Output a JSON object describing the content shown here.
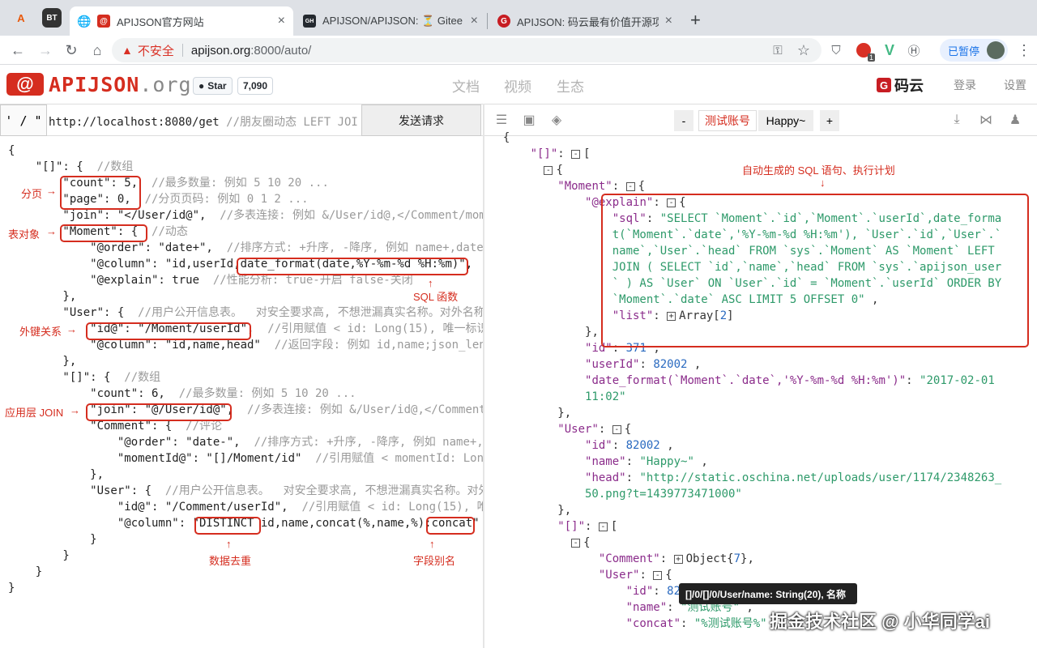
{
  "browser": {
    "pinned": [
      "A",
      "BT",
      "🌐"
    ],
    "tabs": [
      {
        "title": "APIJSON官方网站",
        "favicon": "@"
      },
      {
        "title": "APIJSON/APIJSON: ⏳ Gitee M",
        "favicon": "GH"
      },
      {
        "title": "APIJSON: 码云最有价值开源项目",
        "favicon": "G"
      }
    ],
    "security_label": "不安全",
    "url_host": "apijson.org",
    "url_path": ":8000/auto/",
    "profile_label": "已暂停",
    "ext_badge": "1"
  },
  "site": {
    "logo_mark": "@",
    "logo_name": "APIJSON",
    "logo_suffix": ".org",
    "star_label": "Star",
    "star_count": "7,090",
    "nav": [
      "文档",
      "视频",
      "生态"
    ],
    "gitee_label": "码云",
    "login": "登录",
    "settings": "设置"
  },
  "request": {
    "method": "' / \"",
    "url": "http://localhost:8080/get",
    "url_comment": "  //朋友圈动态 LEFT JOI",
    "send_label": "发送请求"
  },
  "response_toolbar": {
    "minus": "-",
    "account_label": "测试账号",
    "account_name": "Happy~",
    "plus": "+"
  },
  "annotations": {
    "paging": "分页",
    "table_object": "表对象",
    "sql_function": "SQL 函数",
    "foreign_key": "外键关系",
    "app_join": "应用层 JOIN",
    "distinct": "数据去重",
    "field_alias": "字段别名",
    "explain": "自动生成的 SQL 语句、执行计划"
  },
  "tooltip": "[]/0/[]/0/User/name: String(20), 名称",
  "watermark": "掘金技术社区 @ 小华同学ai"
}
